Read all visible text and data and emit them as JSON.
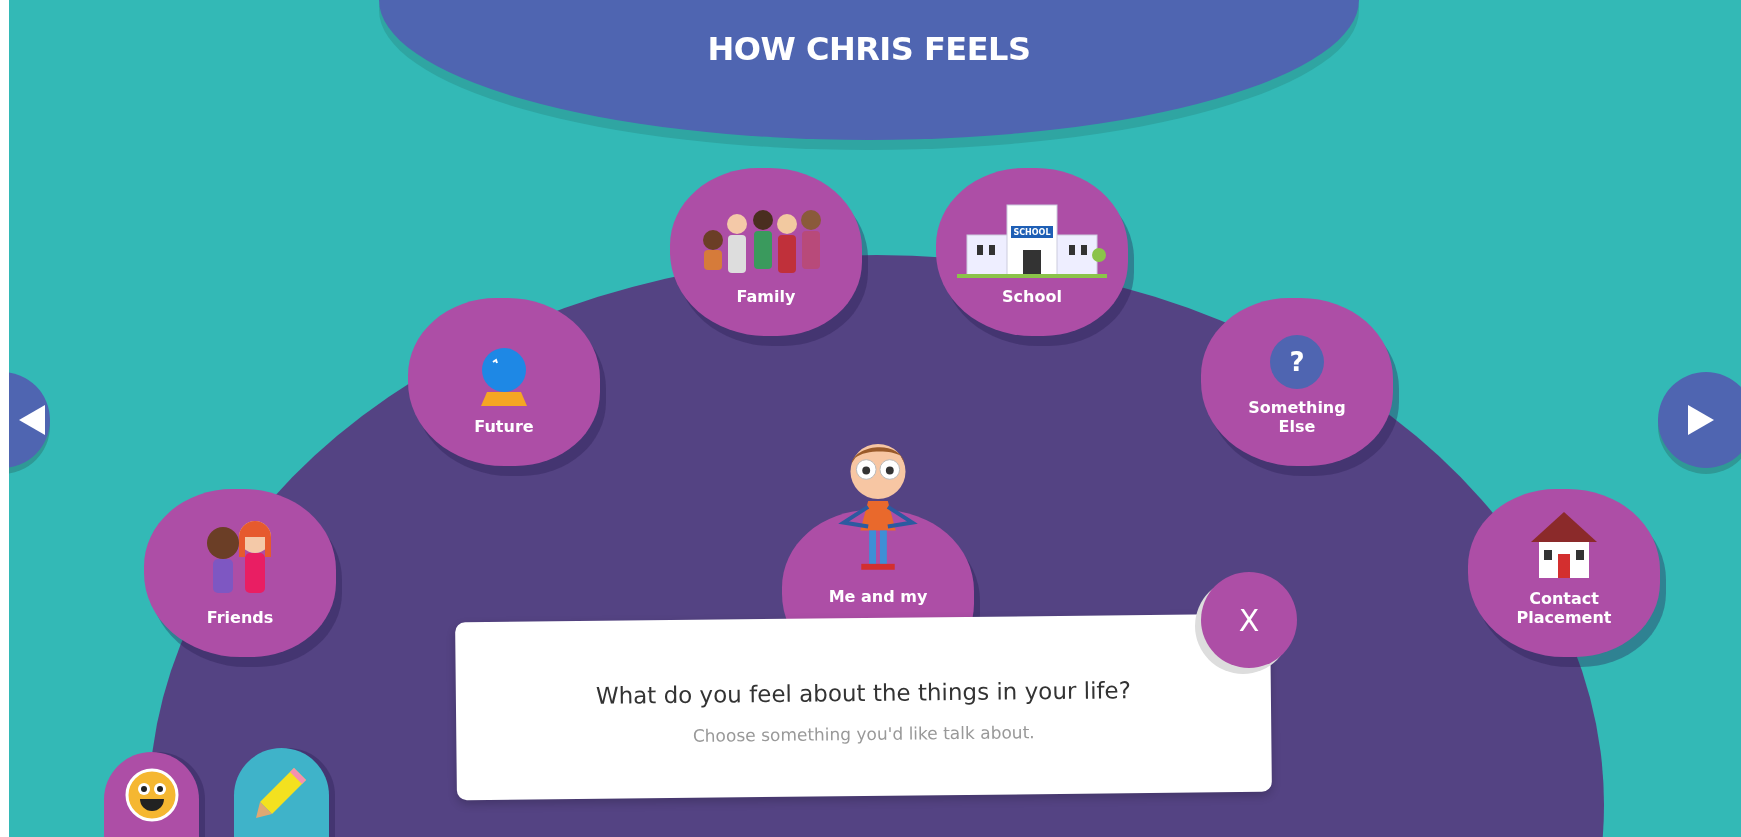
{
  "title": "HOW CHRIS FEELS",
  "topics": [
    {
      "label": "Family",
      "kind": "family"
    },
    {
      "label": "School",
      "kind": "school",
      "sign": "SCHOOL"
    },
    {
      "label": "Future",
      "kind": "future"
    },
    {
      "label": "Something Else",
      "kind": "question",
      "sign": "?"
    },
    {
      "label": "Friends",
      "kind": "friends"
    },
    {
      "label": "Me and my",
      "kind": "me"
    },
    {
      "label": "Contact Placement",
      "kind": "house"
    }
  ],
  "dialog": {
    "question": "What do you feel about the things in your life?",
    "hint": "Choose something you'd like talk about.",
    "close": "X"
  },
  "tools": [
    {
      "kind": "feelings"
    },
    {
      "kind": "pencil"
    }
  ]
}
